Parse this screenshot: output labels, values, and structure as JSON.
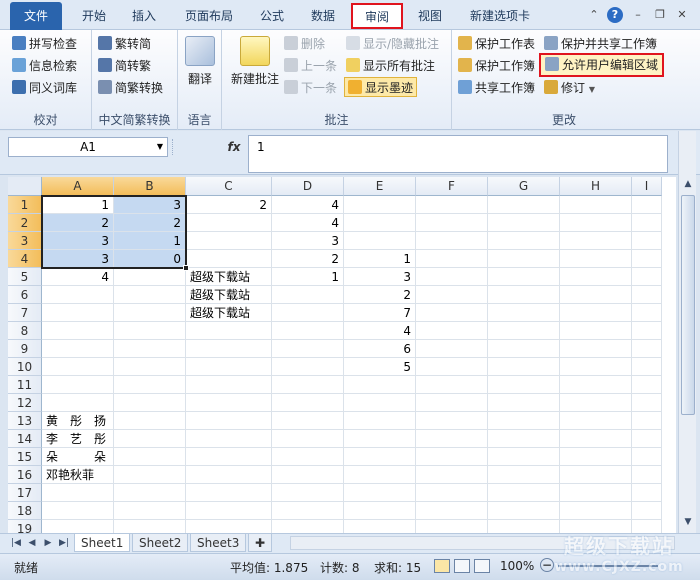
{
  "tabs": {
    "file": "文件",
    "home": "开始",
    "insert": "插入",
    "page_layout": "页面布局",
    "formulas": "公式",
    "data": "数据",
    "review": "审阅",
    "view": "视图",
    "new_tab": "新建选项卡"
  },
  "ribbon": {
    "proofing": {
      "label": "校对",
      "spell_check": "拼写检查",
      "research": "信息检索",
      "thesaurus": "同义词库"
    },
    "chinese": {
      "label": "中文简繁转换",
      "to_simplified": "繁转简",
      "to_traditional": "简转繁",
      "convert": "简繁转换"
    },
    "language": {
      "label": "语言",
      "translate": "翻译"
    },
    "comments": {
      "label": "批注",
      "new_comment": "新建批注",
      "delete": "删除",
      "previous": "上一条",
      "next": "下一条",
      "show_hide": "显示/隐藏批注",
      "show_all": "显示所有批注",
      "show_ink": "显示墨迹"
    },
    "changes": {
      "label": "更改",
      "protect_sheet": "保护工作表",
      "protect_share": "保护并共享工作簿",
      "protect_workbook": "保护工作簿",
      "allow_edit_ranges": "允许用户编辑区域",
      "share_workbook": "共享工作簿",
      "track_changes": "修订"
    }
  },
  "formula_bar": {
    "name_box": "A1",
    "fx": "fx",
    "value": "1"
  },
  "columns": [
    "A",
    "B",
    "C",
    "D",
    "E",
    "F",
    "G",
    "H",
    "I"
  ],
  "rows": [
    "1",
    "2",
    "3",
    "4",
    "5",
    "6",
    "7",
    "8",
    "9",
    "10",
    "11",
    "12",
    "13",
    "14",
    "15",
    "16",
    "17",
    "18",
    "19"
  ],
  "cells": {
    "A1": "1",
    "B1": "3",
    "C1": "2",
    "D1": "4",
    "A2": "2",
    "B2": "2",
    "D2": "4",
    "A3": "3",
    "B3": "1",
    "D3": "3",
    "A4": "3",
    "B4": "0",
    "D4": "2",
    "E4": "1",
    "A5": "4",
    "C5": "超级下载站",
    "D5": "1",
    "E5": "3",
    "C6": "超级下载站",
    "E6": "2",
    "C7": "超级下载站",
    "E7": "7",
    "E8": "4",
    "E9": "6",
    "E10": "5",
    "A13": "黄　彤　扬",
    "A14": "李　艺　彤",
    "A15": "朵　　　朵",
    "A16": "邓艳秋菲"
  },
  "sheets": [
    "Sheet1",
    "Sheet2",
    "Sheet3"
  ],
  "status": {
    "ready": "就绪",
    "average": "平均值: 1.875",
    "count": "计数: 8",
    "sum": "求和: 15",
    "zoom": "100%"
  },
  "watermark": {
    "line1": "超级下载站",
    "line2": "www.CJXZ.com"
  }
}
